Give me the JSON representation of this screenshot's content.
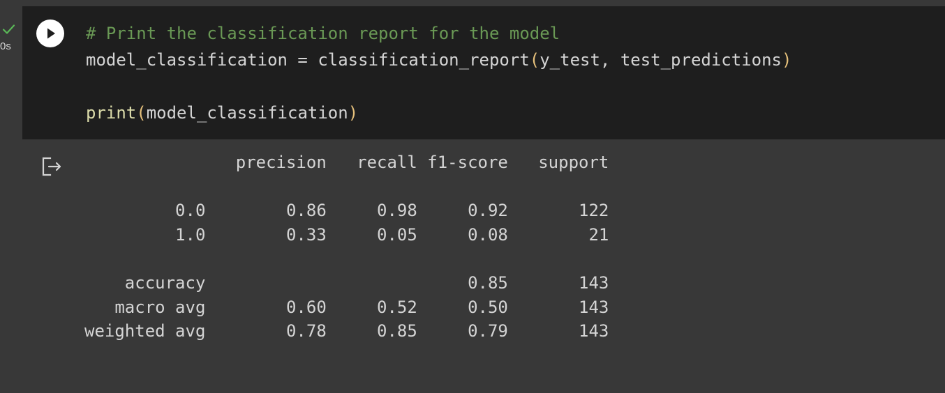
{
  "cell": {
    "execution_time": "0s",
    "status": "completed",
    "code_lines": [
      {
        "segments": [
          {
            "text": "# Print the classification report for the model",
            "kind": "comment"
          }
        ]
      },
      {
        "segments": [
          {
            "text": "model_classification = classification_report",
            "kind": "text"
          },
          {
            "text": "(",
            "kind": "paren"
          },
          {
            "text": "y_test, test_predictions",
            "kind": "text"
          },
          {
            "text": ")",
            "kind": "paren"
          }
        ]
      },
      {
        "segments": []
      },
      {
        "segments": [
          {
            "text": "print",
            "kind": "fn"
          },
          {
            "text": "(",
            "kind": "paren"
          },
          {
            "text": "model_classification",
            "kind": "text"
          },
          {
            "text": ")",
            "kind": "paren"
          }
        ]
      }
    ]
  },
  "output": {
    "header": [
      "",
      "precision",
      "recall",
      "f1-score",
      "support"
    ],
    "rows": [
      [
        "",
        "",
        "",
        "",
        ""
      ],
      [
        "0.0",
        "0.86",
        "0.98",
        "0.92",
        "122"
      ],
      [
        "1.0",
        "0.33",
        "0.05",
        "0.08",
        "21"
      ],
      [
        "",
        "",
        "",
        "",
        ""
      ],
      [
        "accuracy",
        "",
        "",
        "0.85",
        "143"
      ],
      [
        "macro avg",
        "0.60",
        "0.52",
        "0.50",
        "143"
      ],
      [
        "weighted avg",
        "0.78",
        "0.85",
        "0.79",
        "143"
      ]
    ]
  },
  "colors": {
    "page_background": "#383838",
    "cell_background": "#1e1e1e",
    "comment": "#6a9955",
    "text": "#d4d4d4",
    "paren": "#e5c07b",
    "function": "#dcdcaa",
    "success_check": "#5ab857"
  },
  "icons": {
    "status": "check-icon",
    "run": "play-icon",
    "output": "output-redirect-icon"
  }
}
